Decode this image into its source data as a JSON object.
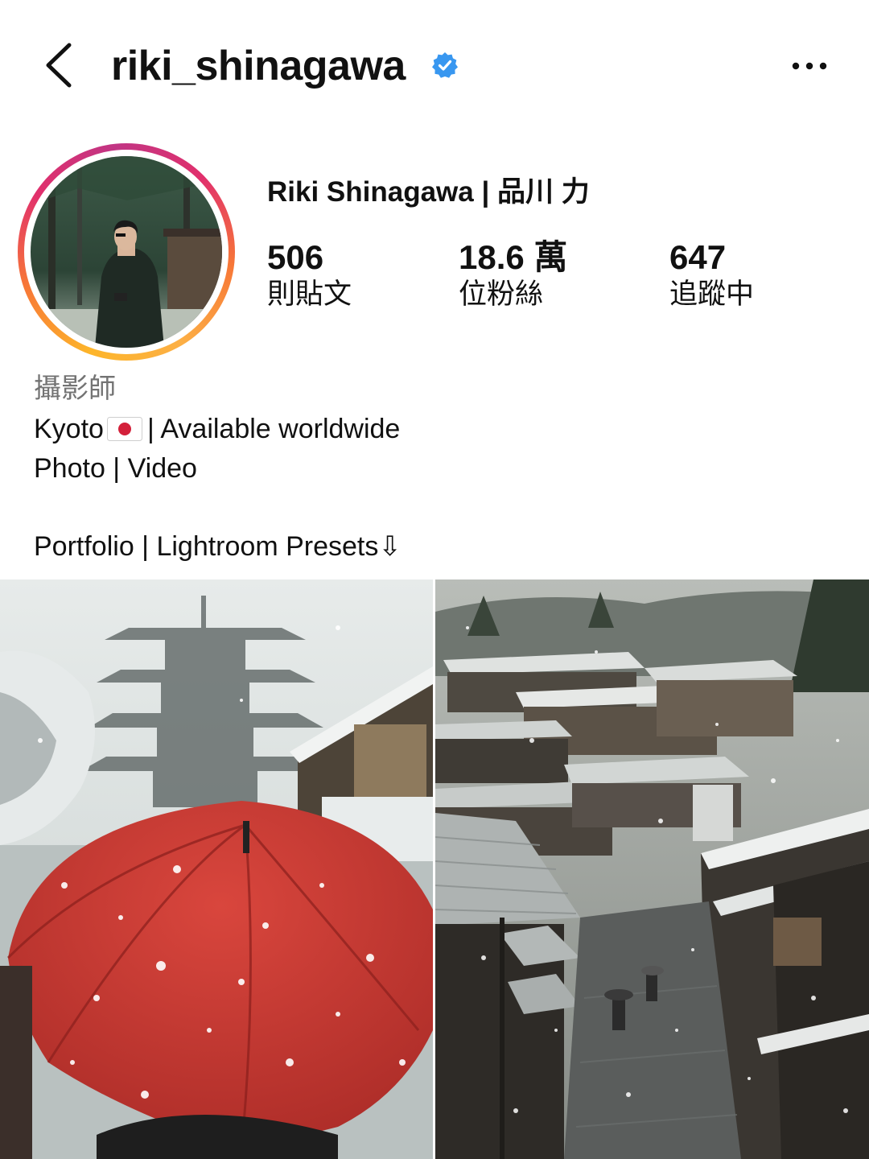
{
  "header": {
    "username": "riki_shinagawa",
    "verified": true,
    "back_icon": "chevron-left-icon",
    "more_icon": "more-horizontal-icon"
  },
  "profile": {
    "display_name": "Riki Shinagawa | 品川 力",
    "stats": {
      "posts_value": "506",
      "posts_label": "則貼文",
      "followers_value": "18.6 萬",
      "followers_label": "位粉絲",
      "following_value": "647",
      "following_label": "追蹤中"
    }
  },
  "bio": {
    "category": "攝影師",
    "line1_prefix": "Kyoto",
    "line1_suffix": "| Available worldwide",
    "line2": "Photo | Video",
    "line3": "Portfolio | Lightroom Presets⇩"
  },
  "colors": {
    "verified_blue": "#3897f0",
    "category_gray": "#737373",
    "story_ring": [
      "#fdb52a",
      "#f77737",
      "#e1306c",
      "#c13584"
    ],
    "umbrella_red": "#c8372f"
  }
}
